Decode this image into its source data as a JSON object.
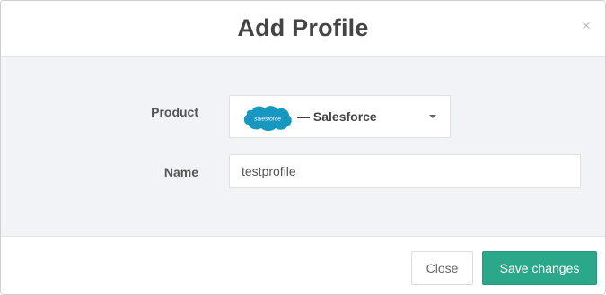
{
  "modal": {
    "title": "Add Profile",
    "close_icon": "×"
  },
  "form": {
    "product_label": "Product",
    "product_value": "— Salesforce",
    "product_logo_text": "salesforce",
    "name_label": "Name",
    "name_value": "testprofile"
  },
  "footer": {
    "close_label": "Close",
    "save_label": "Save changes"
  },
  "colors": {
    "primary": "#2aa889",
    "salesforce_blue": "#1798c1",
    "body_background": "#f2f3f6"
  },
  "icons": {
    "close": "close-icon",
    "dropdown": "caret-down-icon",
    "product_logo": "salesforce-logo-icon"
  }
}
